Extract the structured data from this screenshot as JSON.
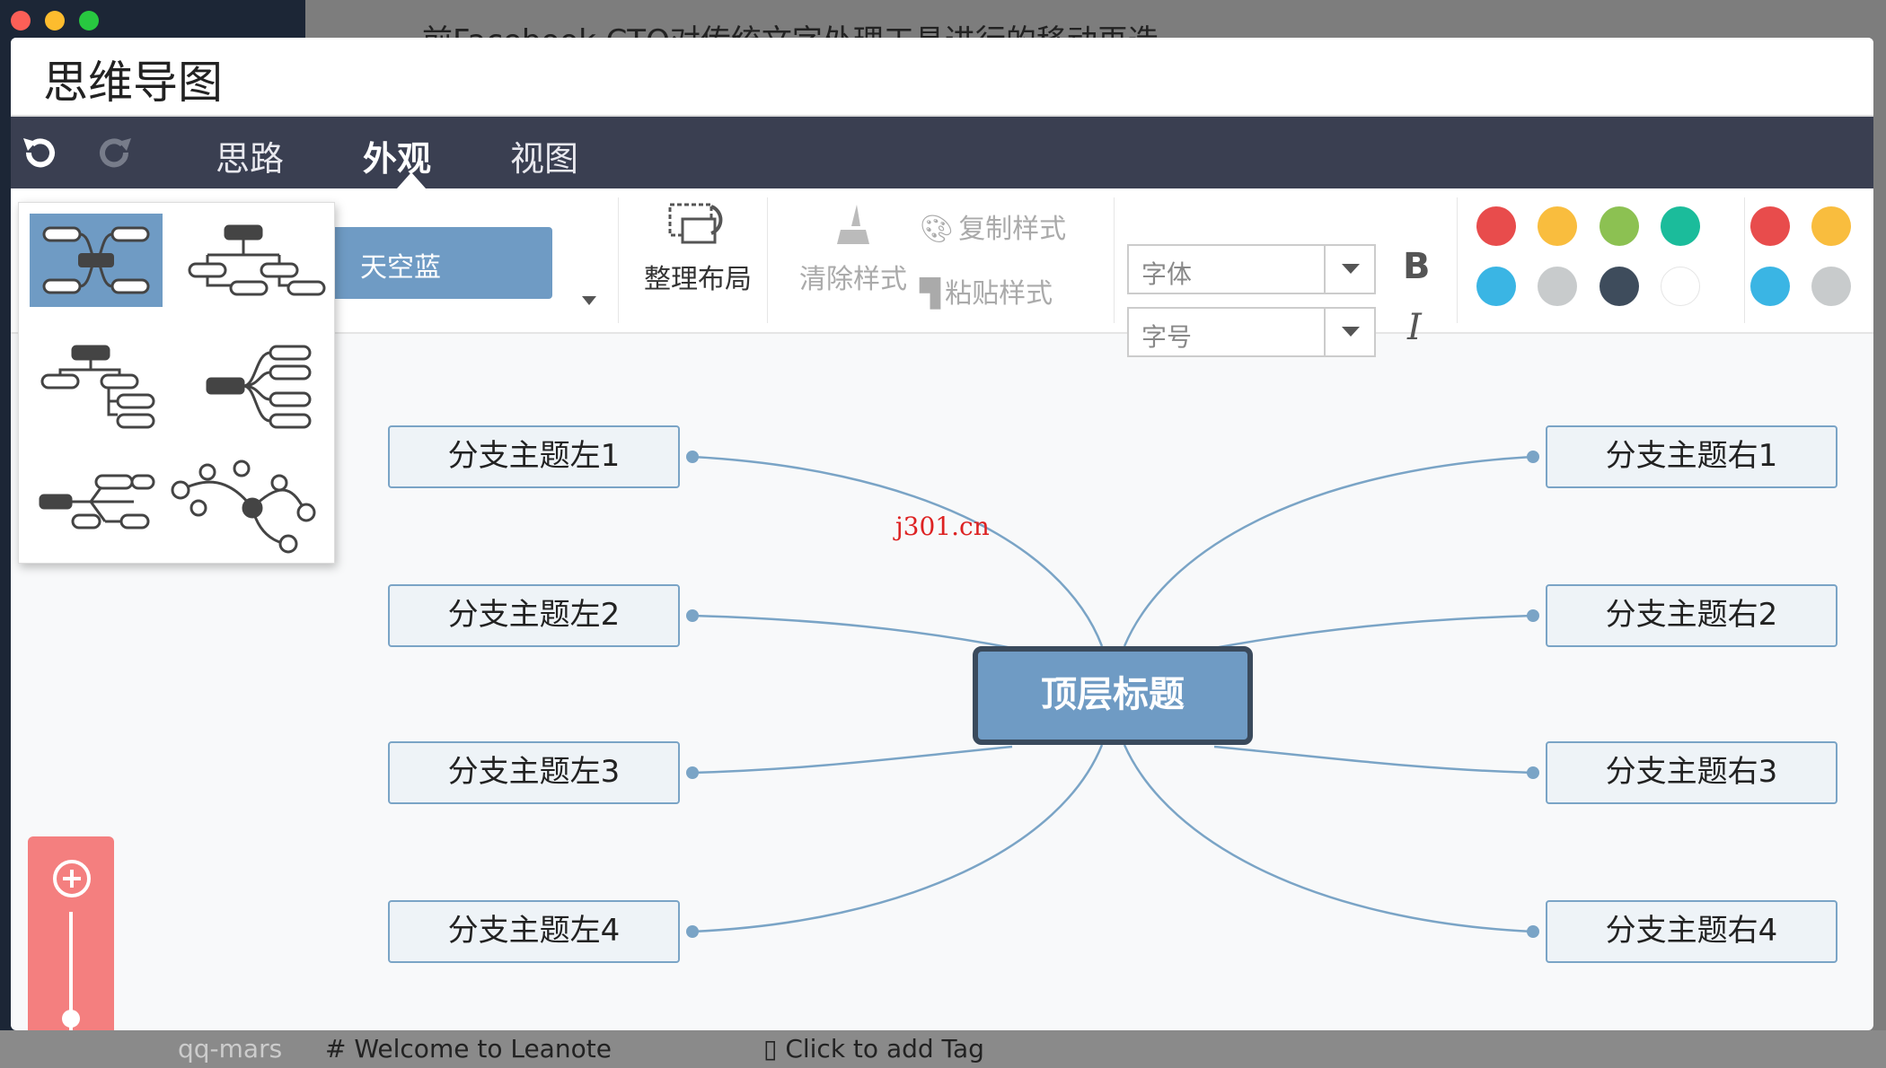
{
  "background": {
    "window_title": "前Facebook CTO对传统文字处理工具进行的移动再造",
    "status_user": "qq-mars",
    "note_title": "# Welcome to Leanote",
    "tag_prompt": "Click to add Tag"
  },
  "modal": {
    "title": "思维导图"
  },
  "nav": {
    "undo_icon": "undo-icon",
    "redo_icon": "redo-icon",
    "tabs": [
      {
        "label": "思路"
      },
      {
        "label": "外观",
        "active": true
      },
      {
        "label": "视图"
      }
    ]
  },
  "toolbar": {
    "theme": "天空蓝",
    "arrange": "整理布局",
    "clear_style": "清除样式",
    "copy_style": "复制样式",
    "paste_style": "粘贴样式",
    "font_placeholder": "字体",
    "size_placeholder": "字号",
    "bold": "B",
    "italic": "I",
    "colors": [
      "#e84c4c",
      "#f9bd3e",
      "#8cc152",
      "#1bbc9b",
      "#3ab5e4",
      "#c8cbcc",
      "#3e4c5c",
      "#ffffff"
    ],
    "colors_extra": [
      "#e84c4c",
      "#f9bd3e",
      "#3ab5e4",
      "#c8cbcc"
    ]
  },
  "layouts": [
    "mind-map",
    "org-chart",
    "tree-right",
    "logic-right",
    "fishbone",
    "free-graph"
  ],
  "mindmap": {
    "root": "顶层标题",
    "left": [
      "分支主题左1",
      "分支主题左2",
      "分支主题左3",
      "分支主题左4"
    ],
    "right": [
      "分支主题右1",
      "分支主题右2",
      "分支主题右3",
      "分支主题右4"
    ],
    "line_color": "#7aa4c6"
  },
  "watermark": "j301.cn",
  "zoom_slider": {
    "level": 0.1
  }
}
